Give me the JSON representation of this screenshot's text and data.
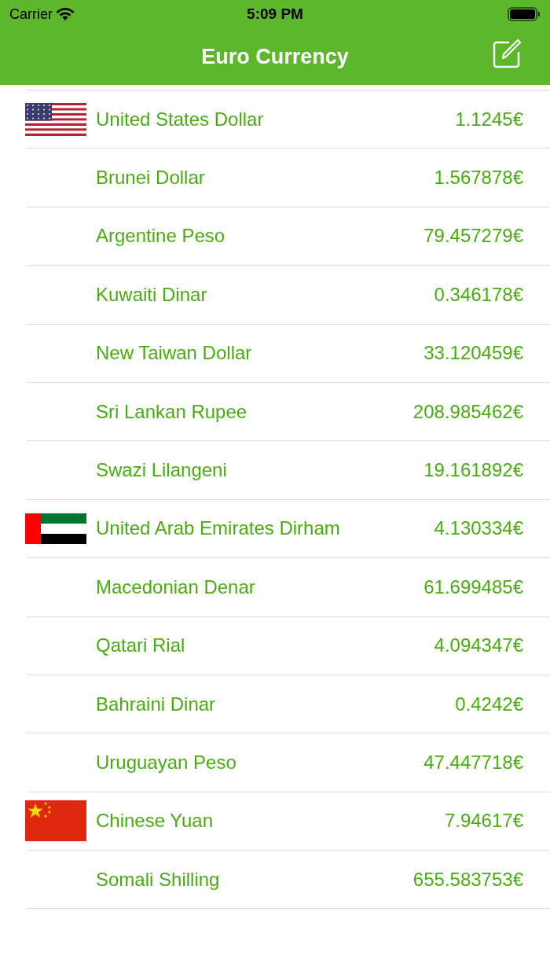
{
  "status_bar": {
    "carrier": "Carrier",
    "time": "5:09 PM"
  },
  "nav_bar": {
    "title": "Euro Currency"
  },
  "rows": [
    {
      "kind": "us",
      "name": "United States Dollar",
      "rate": "1.1245€"
    },
    {
      "kind": "plain",
      "name": "Brunei Dollar",
      "rate": "1.567878€"
    },
    {
      "kind": "plain",
      "name": "Argentine Peso",
      "rate": "79.457279€"
    },
    {
      "kind": "plain",
      "name": "Kuwaiti Dinar",
      "rate": "0.346178€"
    },
    {
      "kind": "plain",
      "name": "New Taiwan Dollar",
      "rate": "33.120459€"
    },
    {
      "kind": "plain",
      "name": "Sri Lankan Rupee",
      "rate": "208.985462€"
    },
    {
      "kind": "plain",
      "name": "Swazi Lilangeni",
      "rate": "19.161892€"
    },
    {
      "kind": "ae",
      "name": "United Arab Emirates Dirham",
      "rate": "4.130334€"
    },
    {
      "kind": "plain",
      "name": "Macedonian Denar",
      "rate": "61.699485€"
    },
    {
      "kind": "plain",
      "name": "Qatari Rial",
      "rate": "4.094347€"
    },
    {
      "kind": "plain",
      "name": "Bahraini Dinar",
      "rate": "0.4242€"
    },
    {
      "kind": "plain",
      "name": "Uruguayan Peso",
      "rate": "47.447718€"
    },
    {
      "kind": "cn",
      "name": "Chinese Yuan",
      "rate": "7.94617€"
    },
    {
      "kind": "plain",
      "name": "Somali Shilling",
      "rate": "655.583753€"
    }
  ]
}
